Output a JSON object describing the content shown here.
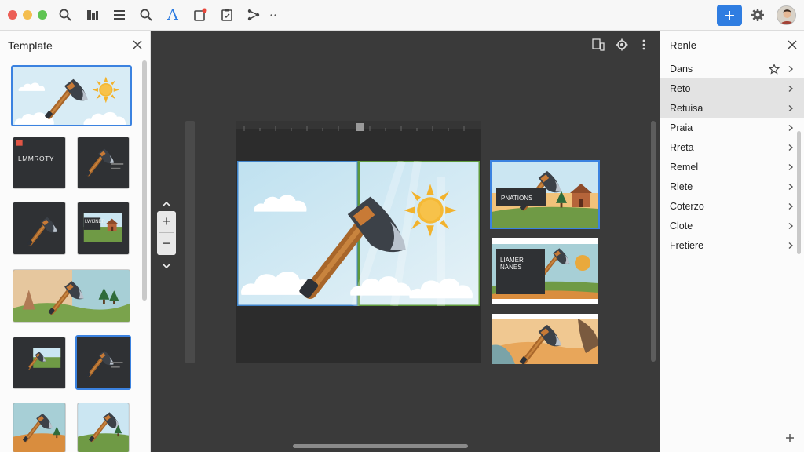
{
  "toolbar": {
    "window_buttons": [
      "#ec5f57",
      "#f4be4f",
      "#5fc453"
    ],
    "tools": [
      "search-icon",
      "library-icon",
      "list-icon",
      "search-icon",
      "text-style-icon",
      "notification-icon",
      "checklist-icon",
      "share-icon"
    ],
    "text_tool_glyph": "A",
    "more_glyph": "• •",
    "plus_glyph": "+"
  },
  "template_panel": {
    "title": "Template",
    "thumb_text_1": "LMMROTY",
    "thumb_text_2": "LWIJNER"
  },
  "editor": {
    "zoom_in": "+",
    "zoom_out": "−"
  },
  "side_slides": [
    {
      "title": "PNATIONS"
    },
    {
      "title": "LIAMER NANES"
    },
    {
      "title": ""
    }
  ],
  "right_panel": {
    "title": "Renle",
    "items": [
      {
        "label": "Dans",
        "highlighted": false,
        "star": true
      },
      {
        "label": "Reto",
        "highlighted": true,
        "star": false
      },
      {
        "label": "Retuisa",
        "highlighted": true,
        "star": false
      },
      {
        "label": "Praia",
        "highlighted": false,
        "star": false
      },
      {
        "label": "Rreta",
        "highlighted": false,
        "star": false
      },
      {
        "label": "Remel",
        "highlighted": false,
        "star": false
      },
      {
        "label": "Riete",
        "highlighted": false,
        "star": false
      },
      {
        "label": "Coterzo",
        "highlighted": false,
        "star": false
      },
      {
        "label": "Clote",
        "highlighted": false,
        "star": false
      },
      {
        "label": "Fretiere",
        "highlighted": false,
        "star": false
      }
    ]
  },
  "colors": {
    "accent": "#2f7de1",
    "editor_bg": "#3a3a3a",
    "sky": "#cbe6f2",
    "sun": "#f4b731",
    "axe_head": "#3c4148",
    "axe_handle": "#b26e2e",
    "grass": "#6f9a45"
  }
}
